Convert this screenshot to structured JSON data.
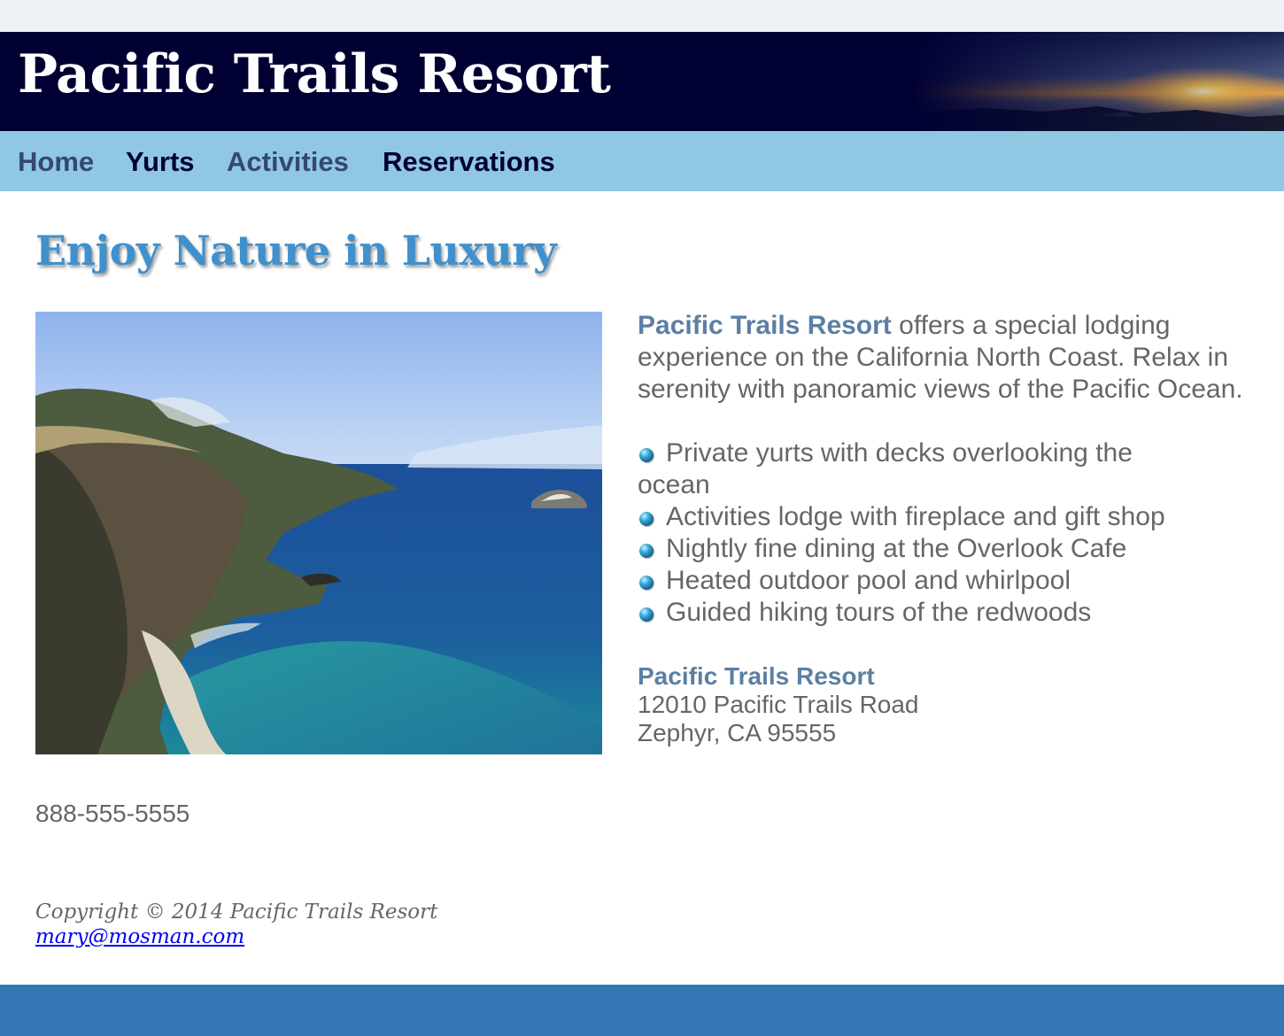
{
  "header": {
    "title": "Pacific Trails Resort"
  },
  "nav": {
    "items": [
      {
        "label": "Home"
      },
      {
        "label": "Yurts"
      },
      {
        "label": "Activities"
      },
      {
        "label": "Reservations"
      }
    ]
  },
  "main": {
    "heading": "Enjoy Nature in Luxury",
    "intro_brand": "Pacific Trails Resort",
    "intro_text": " offers a special lodging experience on the California North Coast. Relax in serenity with panoramic views of the Pacific Ocean.",
    "features": [
      "Private yurts with decks overlooking the",
      "ocean",
      "Activities lodge with fireplace and gift shop",
      "Nightly fine dining at the Overlook Cafe",
      "Heated outdoor pool and whirlpool",
      "Guided hiking tours of the redwoods"
    ],
    "address": {
      "name": "Pacific Trails Resort",
      "street": "12010 Pacific Trails Road",
      "city": "Zephyr, CA 95555"
    },
    "phone": "888-555-5555"
  },
  "footer": {
    "copyright": "Copyright © 2014 Pacific Trails Resort",
    "email": "mary@mosman.com"
  },
  "colors": {
    "header_bg": "#000033",
    "nav_bg": "#90c7e3",
    "heading": "#3f90cc",
    "brand_text": "#5c7fa3",
    "body_text": "#666666",
    "bottom_bar": "#3277b3"
  },
  "icons": {
    "bullet": "blue-sphere-bullet-icon"
  }
}
